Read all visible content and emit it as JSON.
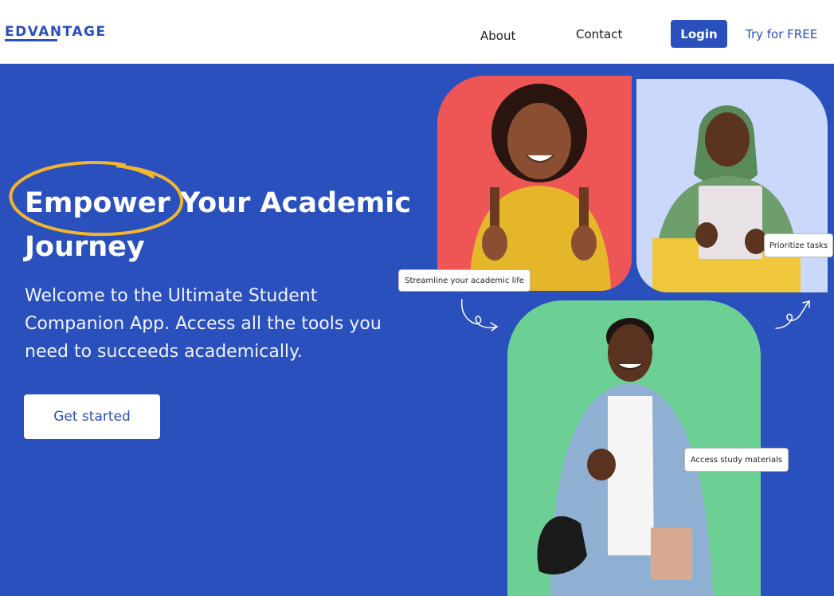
{
  "nav": {
    "logo": "EDVANTAGE",
    "about": "About",
    "contact": "Contact",
    "login": "Login",
    "try_free": "Try for FREE"
  },
  "hero": {
    "headline_word_1": "Empower",
    "headline_rest_line_1": "Your Academic",
    "headline_line_2": "Journey",
    "subtext": "Welcome to the Ultimate Student Companion App. Access all the tools you need to succeeds academically.",
    "cta": "Get started"
  },
  "tags": {
    "streamline": "Streamline your academic life",
    "prioritize": "Prioritize tasks",
    "access": "Access study materials"
  },
  "colors": {
    "brand_blue": "#2a50be",
    "highlight_yellow": "#f2b52b",
    "card_red": "#ee5656",
    "card_lavender": "#c9d8fb",
    "card_green": "#6ccf94",
    "nav_bg": "#ffffff"
  },
  "icons": {
    "headline_circle": "hand-drawn-circle-icon",
    "arrow_left": "curly-arrow-down-right-icon",
    "arrow_right": "curly-arrow-up-right-icon"
  }
}
